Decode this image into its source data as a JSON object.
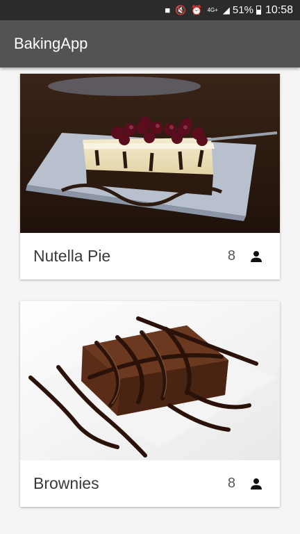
{
  "status_bar": {
    "network": "4G+",
    "battery": "51%",
    "time": "10:58"
  },
  "app_bar": {
    "title": "BakingApp"
  },
  "recipes": [
    {
      "name": "Nutella Pie",
      "servings": "8",
      "icon": "person-icon"
    },
    {
      "name": "Brownies",
      "servings": "8",
      "icon": "person-icon"
    }
  ]
}
